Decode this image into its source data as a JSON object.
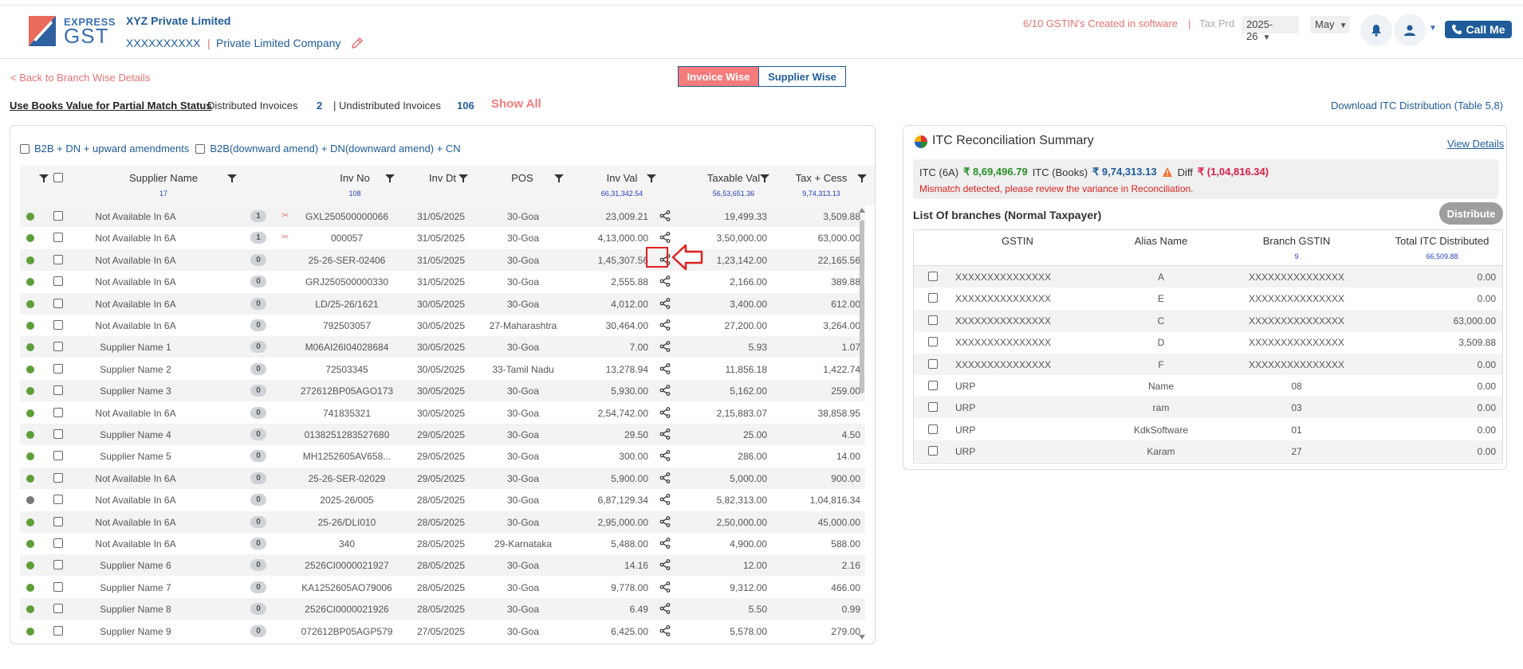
{
  "header": {
    "logo_top": "EXPRESS",
    "logo_bottom": "GST",
    "company_name": "XYZ Private Limited",
    "company_gstin": "XXXXXXXXXX",
    "company_separator": "|",
    "company_type": "Private Limited Company",
    "gstin_created": "6/10 GSTIN's Created in software",
    "separator": "|",
    "tax_period_label": "Tax Prd",
    "year": "2025-26",
    "month": "May",
    "call_me": "Call Me"
  },
  "nav": {
    "back_link": "< Back to Branch Wise Details",
    "toggle_invoice": "Invoice Wise",
    "toggle_supplier": "Supplier Wise"
  },
  "summary_bar": {
    "books_link": "Use Books Value for Partial Match Status",
    "distributed_label": "Distributed Invoices",
    "distributed_count": "2",
    "undistributed_label": "| Undistributed Invoices",
    "undistributed_count": "106",
    "show_all": "Show All",
    "download_link": "Download ITC Distribution (Table 5,8)"
  },
  "filters": {
    "option1": "B2B + DN + upward amendments",
    "option2": "B2B(downward amend) + DN(downward amend) + CN"
  },
  "invoice_table": {
    "headers": {
      "supplier": "Supplier Name",
      "inv_no": "Inv No",
      "inv_dt": "Inv Dt",
      "pos": "POS",
      "inv_val": "Inv Val",
      "taxable_val": "Taxable Val",
      "tax_cess": "Tax + Cess"
    },
    "sums": {
      "supplier": "17",
      "inv_no": "108",
      "inv_val": "66,31,342.54",
      "taxable_val": "56,53,651.36",
      "tax_cess": "9,74,313.13"
    },
    "rows": [
      {
        "status": "green",
        "supplier": "Not Available In 6A",
        "badge": "1",
        "split": true,
        "inv_no": "GXL250500000066",
        "inv_dt": "31/05/2025",
        "pos": "30-Goa",
        "inv_val": "23,009.21",
        "taxable": "19,499.33",
        "tax": "3,509.88"
      },
      {
        "status": "green",
        "supplier": "Not Available In 6A",
        "badge": "1",
        "split": true,
        "inv_no": "000057",
        "inv_dt": "31/05/2025",
        "pos": "30-Goa",
        "inv_val": "4,13,000.00",
        "taxable": "3,50,000.00",
        "tax": "63,000.00"
      },
      {
        "status": "green",
        "supplier": "Not Available In 6A",
        "badge": "0",
        "split": false,
        "inv_no": "25-26-SER-02406",
        "inv_dt": "31/05/2025",
        "pos": "30-Goa",
        "inv_val": "1,45,307.56",
        "taxable": "1,23,142.00",
        "tax": "22,165.56"
      },
      {
        "status": "green",
        "supplier": "Not Available In 6A",
        "badge": "0",
        "split": false,
        "inv_no": "GRJ250500000330",
        "inv_dt": "31/05/2025",
        "pos": "30-Goa",
        "inv_val": "2,555.88",
        "taxable": "2,166.00",
        "tax": "389.88"
      },
      {
        "status": "green",
        "supplier": "Not Available In 6A",
        "badge": "0",
        "split": false,
        "inv_no": "LD/25-26/1621",
        "inv_dt": "30/05/2025",
        "pos": "30-Goa",
        "inv_val": "4,012.00",
        "taxable": "3,400.00",
        "tax": "612.00"
      },
      {
        "status": "green",
        "supplier": "Not Available In 6A",
        "badge": "0",
        "split": false,
        "inv_no": "792503057",
        "inv_dt": "30/05/2025",
        "pos": "27-Maharashtra",
        "inv_val": "30,464.00",
        "taxable": "27,200.00",
        "tax": "3,264.00"
      },
      {
        "status": "green",
        "supplier": "Supplier Name 1",
        "badge": "0",
        "split": false,
        "inv_no": "M06AI26I04028684",
        "inv_dt": "30/05/2025",
        "pos": "30-Goa",
        "inv_val": "7.00",
        "taxable": "5.93",
        "tax": "1.07"
      },
      {
        "status": "green",
        "supplier": "Supplier Name 2",
        "badge": "0",
        "split": false,
        "inv_no": "72503345",
        "inv_dt": "30/05/2025",
        "pos": "33-Tamil Nadu",
        "inv_val": "13,278.94",
        "taxable": "11,856.18",
        "tax": "1,422.74"
      },
      {
        "status": "green",
        "supplier": "Supplier Name 3",
        "badge": "0",
        "split": false,
        "inv_no": "272612BP05AGO173",
        "inv_dt": "30/05/2025",
        "pos": "30-Goa",
        "inv_val": "5,930.00",
        "taxable": "5,162.00",
        "tax": "259.00"
      },
      {
        "status": "green",
        "supplier": "Not Available In 6A",
        "badge": "0",
        "split": false,
        "inv_no": "741835321",
        "inv_dt": "30/05/2025",
        "pos": "30-Goa",
        "inv_val": "2,54,742.00",
        "taxable": "2,15,883.07",
        "tax": "38,858.95"
      },
      {
        "status": "green",
        "supplier": "Supplier Name 4",
        "badge": "0",
        "split": false,
        "inv_no": "0138251283527680",
        "inv_dt": "29/05/2025",
        "pos": "30-Goa",
        "inv_val": "29.50",
        "taxable": "25.00",
        "tax": "4.50"
      },
      {
        "status": "green",
        "supplier": "Supplier Name 5",
        "badge": "0",
        "split": false,
        "inv_no": "MH1252605AV658...",
        "inv_dt": "29/05/2025",
        "pos": "30-Goa",
        "inv_val": "300.00",
        "taxable": "286.00",
        "tax": "14.00"
      },
      {
        "status": "green",
        "supplier": "Not Available In 6A",
        "badge": "0",
        "split": false,
        "inv_no": "25-26-SER-02029",
        "inv_dt": "29/05/2025",
        "pos": "30-Goa",
        "inv_val": "5,900.00",
        "taxable": "5,000.00",
        "tax": "900.00"
      },
      {
        "status": "grey",
        "supplier": "Not Available In 6A",
        "badge": "0",
        "split": false,
        "inv_no": "2025-26/005",
        "inv_dt": "28/05/2025",
        "pos": "30-Goa",
        "inv_val": "6,87,129.34",
        "taxable": "5,82,313.00",
        "tax": "1,04,816.34"
      },
      {
        "status": "green",
        "supplier": "Not Available In 6A",
        "badge": "0",
        "split": false,
        "inv_no": "25-26/DLI010",
        "inv_dt": "28/05/2025",
        "pos": "30-Goa",
        "inv_val": "2,95,000.00",
        "taxable": "2,50,000.00",
        "tax": "45,000.00"
      },
      {
        "status": "green",
        "supplier": "Not Available In 6A",
        "badge": "0",
        "split": false,
        "inv_no": "340",
        "inv_dt": "28/05/2025",
        "pos": "29-Karnataka",
        "inv_val": "5,488.00",
        "taxable": "4,900.00",
        "tax": "588.00"
      },
      {
        "status": "green",
        "supplier": "Supplier Name 6",
        "badge": "0",
        "split": false,
        "inv_no": "2526CI0000021927",
        "inv_dt": "28/05/2025",
        "pos": "30-Goa",
        "inv_val": "14.16",
        "taxable": "12.00",
        "tax": "2.16"
      },
      {
        "status": "green",
        "supplier": "Supplier Name 7",
        "badge": "0",
        "split": false,
        "inv_no": "KA1252605AO79006",
        "inv_dt": "28/05/2025",
        "pos": "30-Goa",
        "inv_val": "9,778.00",
        "taxable": "9,312.00",
        "tax": "466.00"
      },
      {
        "status": "green",
        "supplier": "Supplier Name 8",
        "badge": "0",
        "split": false,
        "inv_no": "2526CI0000021926",
        "inv_dt": "28/05/2025",
        "pos": "30-Goa",
        "inv_val": "6.49",
        "taxable": "5.50",
        "tax": "0.99"
      },
      {
        "status": "green",
        "supplier": "Supplier Name 9",
        "badge": "0",
        "split": false,
        "inv_no": "072612BP05AGP579",
        "inv_dt": "27/05/2025",
        "pos": "30-Goa",
        "inv_val": "6,425.00",
        "taxable": "5,578.00",
        "tax": "279.00"
      }
    ]
  },
  "itc_summary": {
    "title": "ITC Reconciliation Summary",
    "view_details": "View Details",
    "itc_6a_label": "ITC (6A)",
    "itc_6a_value": "₹ 8,69,496.79",
    "itc_books_label": "ITC (Books)",
    "itc_books_value": "₹ 9,74,313.13",
    "diff_label": "Diff",
    "diff_value": "₹ (1,04,816.34)",
    "mismatch_msg": "Mismatch detected, please review the variance in Reconciliation.",
    "branches_title": "List Of branches (Normal Taxpayer)",
    "distribute_btn": "Distribute",
    "headers": {
      "gstin": "GSTIN",
      "alias": "Alias Name",
      "branch_gstin": "Branch GSTIN",
      "total_itc": "Total ITC Distributed"
    },
    "sums": {
      "branch_gstin": "9",
      "total_itc": "66,509.88"
    },
    "rows": [
      {
        "gstin": "XXXXXXXXXXXXXXX",
        "alias": "A",
        "branch": "XXXXXXXXXXXXXXX",
        "total": "0.00"
      },
      {
        "gstin": "XXXXXXXXXXXXXXX",
        "alias": "E",
        "branch": "XXXXXXXXXXXXXXX",
        "total": "0.00"
      },
      {
        "gstin": "XXXXXXXXXXXXXXX",
        "alias": "C",
        "branch": "XXXXXXXXXXXXXXX",
        "total": "63,000.00"
      },
      {
        "gstin": "XXXXXXXXXXXXXXX",
        "alias": "D",
        "branch": "XXXXXXXXXXXXXXX",
        "total": "3,509.88"
      },
      {
        "gstin": "XXXXXXXXXXXXXXX",
        "alias": "F",
        "branch": "XXXXXXXXXXXXXXX",
        "total": "0.00"
      },
      {
        "gstin": "URP",
        "alias": "Name",
        "branch": "08",
        "total": "0.00"
      },
      {
        "gstin": "URP",
        "alias": "ram",
        "branch": "03",
        "total": "0.00"
      },
      {
        "gstin": "URP",
        "alias": "KdkSoftware",
        "branch": "01",
        "total": "0.00"
      },
      {
        "gstin": "URP",
        "alias": "Karam",
        "branch": "27",
        "total": "0.00"
      }
    ]
  },
  "colors": {
    "brand_blue": "#1f5c99",
    "accent_red": "#f47c7c",
    "status_green": "#5e9e3a",
    "status_grey": "#777777"
  }
}
